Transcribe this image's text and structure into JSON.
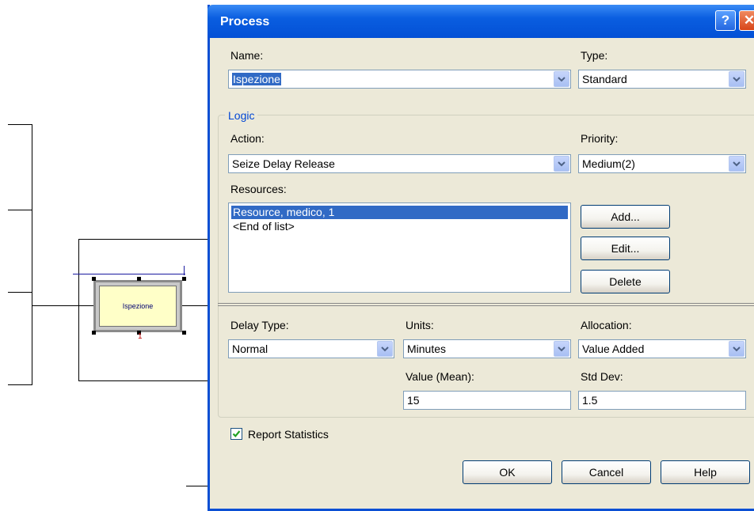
{
  "canvas": {
    "module_label": "Ispezione",
    "connector_mark": "1"
  },
  "dialog": {
    "title": "Process",
    "help_glyph": "?",
    "close_glyph": "✕",
    "name": {
      "label": "Name:",
      "value": "Ispezione"
    },
    "type": {
      "label": "Type:",
      "value": "Standard"
    },
    "logic": {
      "legend": "Logic",
      "action": {
        "label": "Action:",
        "value": "Seize Delay Release"
      },
      "priority": {
        "label": "Priority:",
        "value": "Medium(2)"
      },
      "resources": {
        "label": "Resources:",
        "items": [
          "Resource, medico, 1",
          "<End of list>"
        ],
        "add_label": "Add...",
        "edit_label": "Edit...",
        "delete_label": "Delete"
      },
      "delay_type": {
        "label": "Delay Type:",
        "value": "Normal"
      },
      "units": {
        "label": "Units:",
        "value": "Minutes"
      },
      "allocation": {
        "label": "Allocation:",
        "value": "Value Added"
      },
      "value_mean": {
        "label": "Value (Mean):",
        "value": "15"
      },
      "std_dev": {
        "label": "Std Dev:",
        "value": "1.5"
      }
    },
    "report_statistics": {
      "label": "Report Statistics",
      "checked": true
    },
    "buttons": {
      "ok": "OK",
      "cancel": "Cancel",
      "help": "Help"
    }
  },
  "colors": {
    "titlebar": "#0a5ee0",
    "selection": "#316ac5",
    "dialog_bg": "#ece9d8",
    "group_legend": "#0046d5"
  }
}
